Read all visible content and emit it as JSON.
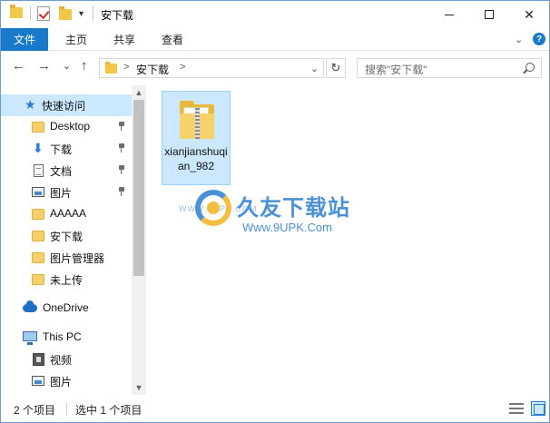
{
  "window": {
    "title": "安下载",
    "quick_access_dropdown": "▾",
    "minimize_glyph": "—",
    "maximize_glyph": "☐",
    "close_glyph": "✕"
  },
  "ribbon": {
    "tabs": [
      {
        "label": "文件",
        "active": true
      },
      {
        "label": "主页"
      },
      {
        "label": "共享"
      },
      {
        "label": "查看"
      }
    ],
    "collapse_glyph": "⌄",
    "help_glyph": "?"
  },
  "nav": {
    "back_glyph": "←",
    "forward_glyph": "→",
    "recent_glyph": "⌄",
    "up_glyph": "↑",
    "breadcrumb_separator": ">",
    "breadcrumb": [
      "安下载"
    ],
    "dropdown_glyph": "⌄",
    "refresh_glyph": "↻",
    "search_placeholder": "搜索\"安下载\""
  },
  "sidebar": {
    "items": [
      {
        "label": "快速访问",
        "icon": "star-icon",
        "active": true
      },
      {
        "label": "Desktop",
        "icon": "folder-icon",
        "pinned": true
      },
      {
        "label": "下载",
        "icon": "download-arrow-icon",
        "pinned": true
      },
      {
        "label": "文档",
        "icon": "document-icon",
        "pinned": true
      },
      {
        "label": "图片",
        "icon": "picture-icon",
        "pinned": true
      },
      {
        "label": "AAAAA",
        "icon": "folder-icon"
      },
      {
        "label": "安下载",
        "icon": "folder-icon"
      },
      {
        "label": "图片管理器",
        "icon": "folder-icon"
      },
      {
        "label": "未上传",
        "icon": "folder-icon"
      },
      {
        "label": "OneDrive",
        "icon": "cloud-icon"
      },
      {
        "label": "This PC",
        "icon": "computer-icon"
      },
      {
        "label": "视频",
        "icon": "video-icon"
      },
      {
        "label": "图片",
        "icon": "picture-icon"
      }
    ],
    "scroll_up_glyph": "▲",
    "scroll_down_glyph": "▼"
  },
  "content": {
    "files": [
      {
        "name": "xianjianshuqian_982",
        "icon": "zip-folder-icon",
        "selected": true
      }
    ],
    "watermark": {
      "brand": "久友下载站",
      "url": "Www.9UPK.Com",
      "faint_url": "WWW.9UPK.COM"
    }
  },
  "status": {
    "item_count": "2 个项目",
    "selection": "选中 1 个项目"
  },
  "colors": {
    "accent": "#1979ca",
    "selection": "#cce8ff",
    "folder": "#f3c847"
  }
}
